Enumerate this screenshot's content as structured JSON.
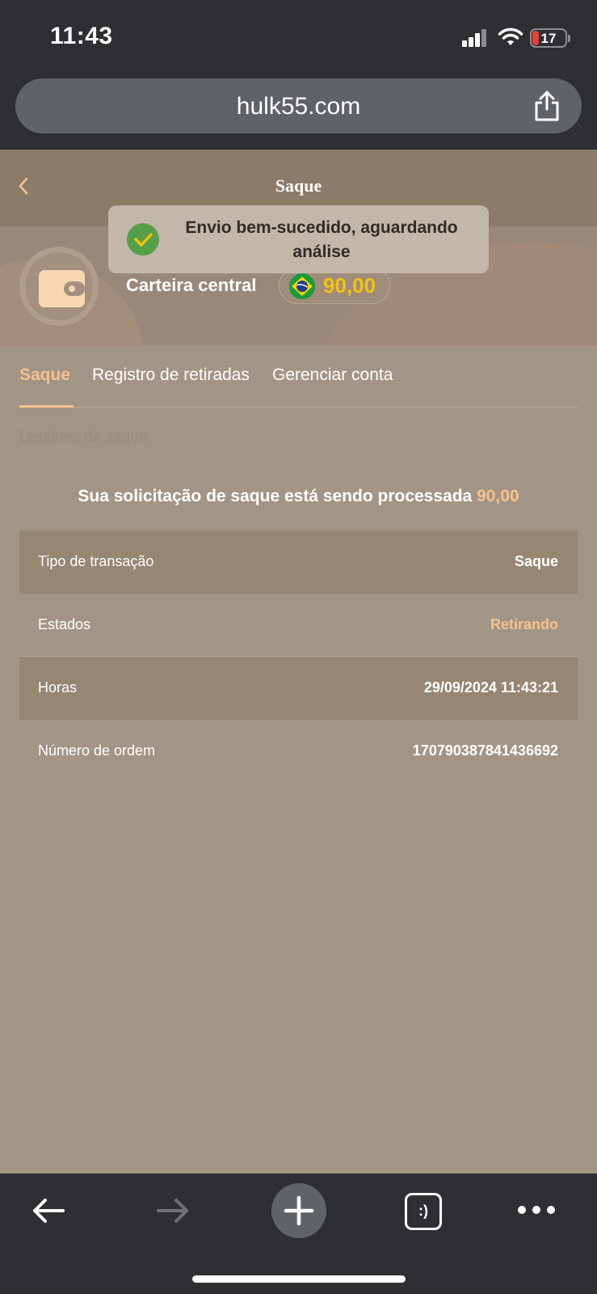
{
  "status_bar": {
    "time": "11:43",
    "battery_level": "17"
  },
  "browser": {
    "url": "hulk55.com",
    "tabs_button_label": ":)"
  },
  "header": {
    "title": "Saque"
  },
  "wallet": {
    "label": "Carteira central",
    "balance": "90,00"
  },
  "toast": {
    "message": "Envio bem-sucedido, aguardando análise"
  },
  "tabs": [
    {
      "label": "Saque",
      "active": true
    },
    {
      "label": "Registro de retiradas",
      "active": false
    },
    {
      "label": "Gerenciar conta",
      "active": false
    }
  ],
  "section": {
    "label": "Detalhes de saque"
  },
  "processing": {
    "message": "Sua solicitação de saque está sendo processada",
    "amount": "90,00"
  },
  "details": [
    {
      "label": "Tipo de transação",
      "value": "Saque"
    },
    {
      "label": "Estados",
      "value": "Retirando"
    },
    {
      "label": "Horas",
      "value": "29/09/2024 11:43:21"
    },
    {
      "label": "Número de ordem",
      "value": "170790387841436692"
    }
  ],
  "colors": {
    "accent": "#f5c28d",
    "balance": "#f1c40f",
    "success": "#56a04a",
    "page_background": "#a39585"
  }
}
